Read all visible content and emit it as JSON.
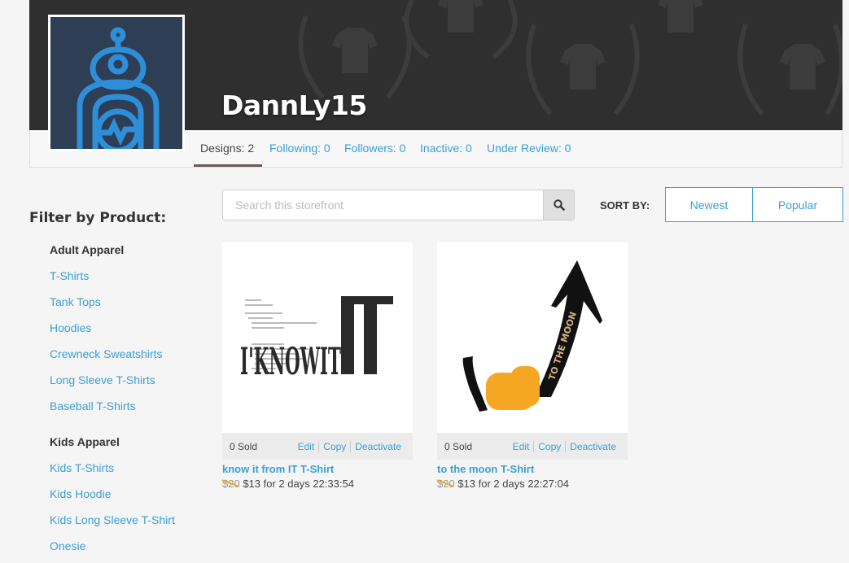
{
  "store": {
    "name": "DannLy15"
  },
  "tabs": [
    {
      "label": "Designs: 2"
    },
    {
      "label": "Following: 0"
    },
    {
      "label": "Followers: 0"
    },
    {
      "label": "Inactive: 0"
    },
    {
      "label": "Under Review: 0"
    }
  ],
  "sidebar": {
    "title": "Filter by Product:",
    "groups": [
      {
        "heading": "Adult Apparel",
        "items": [
          "T-Shirts",
          "Tank Tops",
          "Hoodies",
          "Crewneck Sweatshirts",
          "Long Sleeve T-Shirts",
          "Baseball T-Shirts"
        ]
      },
      {
        "heading": "Kids Apparel",
        "items": [
          "Kids T-Shirts",
          "Kids Hoodie",
          "Kids Long Sleeve T-Shirt",
          "Onesie"
        ]
      }
    ]
  },
  "search": {
    "placeholder": "Search this storefront"
  },
  "sort": {
    "label": "SORT BY:",
    "options": [
      "Newest",
      "Popular"
    ]
  },
  "products": [
    {
      "sold": "0 Sold",
      "actions": [
        "Edit",
        "Copy",
        "Deactivate"
      ],
      "title": "know it from IT T-Shirt",
      "old_price": "$20",
      "price": "$13 for 2 days 22:33:54",
      "art_text": "I'KNOWIT"
    },
    {
      "sold": "0 Sold",
      "actions": [
        "Edit",
        "Copy",
        "Deactivate"
      ],
      "title": "to the moon T-Shirt",
      "old_price": "$20",
      "price": "$13 for 2 days 22:27:04",
      "art_text": "TO THE MOON"
    }
  ],
  "colors": {
    "accent": "#3a9fd6",
    "banner": "#2f2f2f",
    "strike": "#f5a623",
    "avatar_bg": "#2d3e55",
    "avatar_line": "#2e8fd8"
  }
}
